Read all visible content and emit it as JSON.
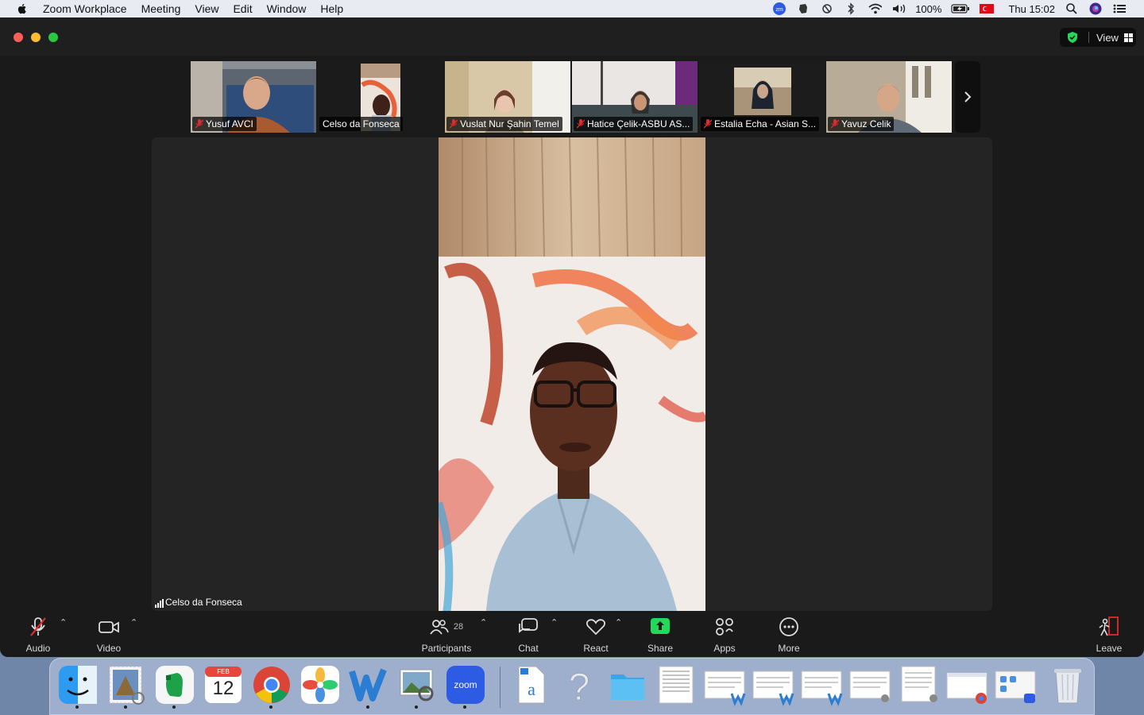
{
  "menubar": {
    "app_name": "Zoom Workplace",
    "menus": [
      "Meeting",
      "View",
      "Edit",
      "Window",
      "Help"
    ],
    "battery": "100%",
    "clock": "Thu 15:02",
    "icons": [
      "zoom-status-icon",
      "evernote-status-icon",
      "sync-icon",
      "bluetooth-icon",
      "wifi-icon",
      "volume-icon",
      "battery-icon",
      "turkey-flag-icon",
      "search-icon",
      "siri-icon",
      "control-center-icon"
    ]
  },
  "window": {
    "view_label": "View",
    "accent": "#23d959"
  },
  "participants_strip": [
    {
      "name": "Yusuf AVCI",
      "muted": true,
      "active": false
    },
    {
      "name": "Celso da Fonseca",
      "muted": false,
      "active": true
    },
    {
      "name": "Vuslat Nur Şahin Temel",
      "muted": true,
      "active": false
    },
    {
      "name": "Hatice Çelik-ASBU AS...",
      "muted": true,
      "active": false
    },
    {
      "name": "Estalia Echa - Asian S...",
      "muted": true,
      "active": false
    },
    {
      "name": "Yavuz Celik",
      "muted": true,
      "active": false
    }
  ],
  "stage": {
    "speaker_name": "Celso da Fonseca"
  },
  "toolbar": {
    "audio": "Audio",
    "video": "Video",
    "participants": "Participants",
    "participants_count": "28",
    "chat": "Chat",
    "react": "React",
    "share": "Share",
    "apps": "Apps",
    "more": "More",
    "leave": "Leave"
  },
  "dock": {
    "calendar_month": "FEB",
    "calendar_day": "12",
    "zoom_label": "zoom",
    "apps": [
      "finder",
      "mail",
      "evernote",
      "calendar",
      "chrome",
      "photos",
      "word",
      "preview",
      "zoom",
      "docx-file",
      "help",
      "folder",
      "document-1",
      "word-doc-1",
      "word-doc-2",
      "word-doc-3",
      "document-2",
      "document-3",
      "chrome-window",
      "zoom-window",
      "trash"
    ]
  }
}
